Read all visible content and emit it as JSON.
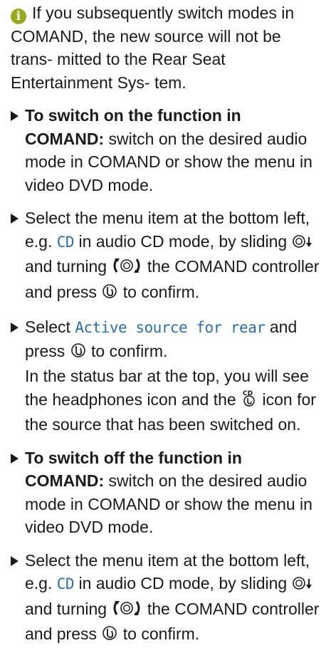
{
  "note": {
    "icon": "info-icon",
    "text": "If you subsequently switch modes in COMAND, the new source will not be trans- mitted to the Rear Seat Entertainment Sys- tem."
  },
  "steps": [
    {
      "bold": "To switch on the function in COMAND:",
      "text": "switch on the desired audio mode in COMAND or show the menu in video DVD mode."
    },
    {
      "pre": "Select the menu item at the bottom left, e.g.",
      "mono": "CD",
      "mid1": "in audio CD mode, by sliding",
      "mid2": "and turning",
      "mid3": "the COMAND controller and press",
      "post": "to confirm."
    },
    {
      "pre": "Select",
      "mono": "Active source for rear",
      "mid": "and press",
      "post": "to confirm.",
      "extra_pre": "In the status bar at the top, you will see the headphones icon and the",
      "extra_post": "icon for the source that has been switched on."
    },
    {
      "bold": "To switch off the function in COMAND:",
      "text": "switch on the desired audio mode in COMAND or show the menu in video DVD mode."
    },
    {
      "pre": "Select the menu item at the bottom left, e.g.",
      "mono": "CD",
      "mid1": "in audio CD mode, by sliding",
      "mid2": "and turning",
      "mid3": "the COMAND controller and press",
      "post": "to confirm."
    }
  ],
  "icons": {
    "slide": "controller-slide-down-icon",
    "turn": "controller-turn-icon",
    "press": "controller-press-icon",
    "cd_source": "cd-source-icon"
  }
}
